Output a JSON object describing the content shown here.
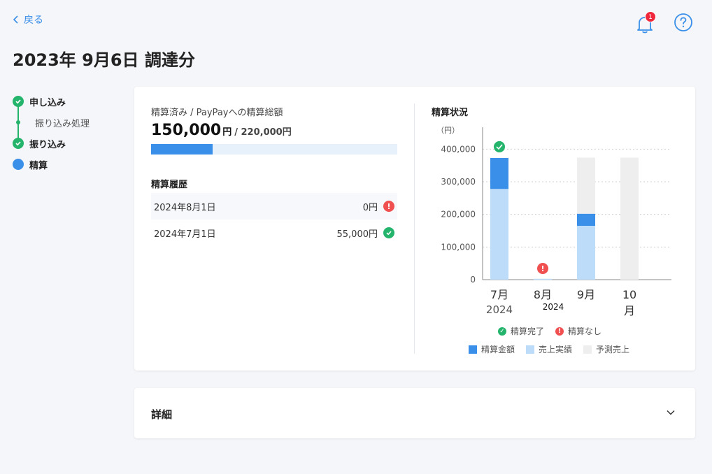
{
  "nav": {
    "back_label": "戻る",
    "notification_count": "1"
  },
  "page": {
    "title": "2023年 9月6日 調達分"
  },
  "steps": [
    {
      "label": "申し込み",
      "state": "done"
    },
    {
      "label": "振り込み処理",
      "state": "sub"
    },
    {
      "label": "振り込み",
      "state": "done"
    },
    {
      "label": "精算",
      "state": "current"
    }
  ],
  "summary": {
    "label": "精算済み / PayPayへの精算総額",
    "paid": "150,000",
    "paid_unit": "円",
    "total": "/ 220,000円",
    "progress_fraction": 0.25
  },
  "history": {
    "title": "精算履歴",
    "rows": [
      {
        "date": "2024年8月1日",
        "amount": "0円",
        "status": "ng"
      },
      {
        "date": "2024年7月1日",
        "amount": "55,000円",
        "status": "ok"
      }
    ]
  },
  "colors": {
    "settled": "#3a8fe8",
    "actual_sales": "#bcdcfa",
    "forecast": "#eeeeee",
    "ok": "#24b46b",
    "ng": "#f05050"
  },
  "chart_data": {
    "type": "bar",
    "title": "精算状況",
    "ylabel": "（円）",
    "ylim": [
      0,
      500000
    ],
    "yticks": [
      {
        "value": 0,
        "label": "0"
      },
      {
        "value": 100000,
        "label": "100,000"
      },
      {
        "value": 200000,
        "label": "200,000"
      },
      {
        "value": 300000,
        "label": "300,000"
      },
      {
        "value": 400000,
        "label": "400,000"
      }
    ],
    "grid": true,
    "categories": [
      {
        "label": "7月",
        "sub": "2024"
      },
      {
        "label": "8月",
        "sub": "2024"
      },
      {
        "label": "9月",
        "sub": ""
      },
      {
        "label": "10月",
        "sub": ""
      }
    ],
    "series": [
      {
        "name": "売上実績",
        "values": [
          278000,
          0,
          165000,
          0
        ]
      },
      {
        "name": "精算金額",
        "values": [
          95000,
          0,
          37000,
          0
        ]
      },
      {
        "name": "予測売上",
        "values": [
          0,
          0,
          172000,
          374000
        ]
      }
    ],
    "markers": [
      "ok",
      "ng",
      "",
      ""
    ],
    "legend_status": [
      {
        "label": "精算完了",
        "status": "ok"
      },
      {
        "label": "精算なし",
        "status": "ng"
      }
    ],
    "legend_series": [
      {
        "label": "精算金額",
        "color": "#3a8fe8"
      },
      {
        "label": "売上実績",
        "color": "#bcdcfa"
      },
      {
        "label": "予測売上",
        "color": "#eeeeee"
      }
    ]
  },
  "detail": {
    "title": "詳細"
  }
}
